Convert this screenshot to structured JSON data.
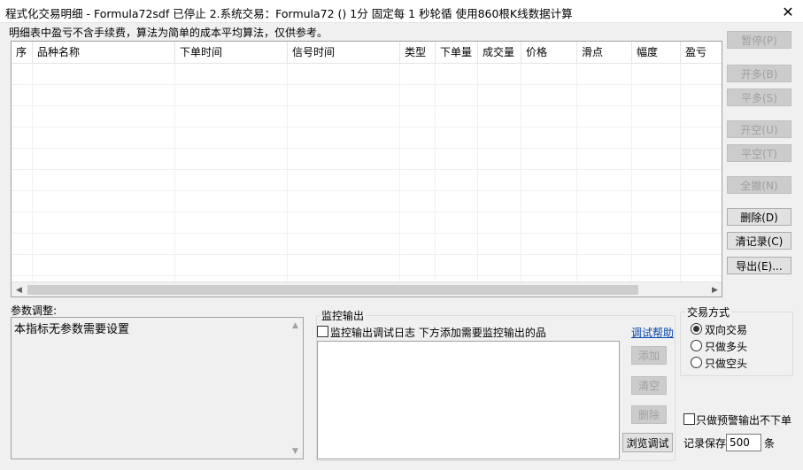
{
  "window": {
    "title": "程式化交易明细 - Formula72sdf 已停止  2.系统交易：Formula72 () 1分 固定每 1 秒轮循 使用860根K线数据计算",
    "close_glyph": "✕"
  },
  "note": "明细表中盈亏不含手续费，算法为简单的成本平均算法，仅供参考。",
  "table": {
    "columns": [
      "序",
      "品种名称",
      "下单时间",
      "信号时间",
      "类型",
      "下单量",
      "成交量",
      "价格",
      "滑点",
      "幅度",
      "盈亏"
    ],
    "rows": []
  },
  "right_buttons": {
    "pause": "暂停(P)",
    "open_long": "开多(B)",
    "close_long": "平多(S)",
    "open_short": "开空(U)",
    "close_short": "平空(T)",
    "cancel_all": "全撤(N)",
    "delete": "删除(D)",
    "clear_records": "清记录(C)",
    "export": "导出(E)..."
  },
  "params": {
    "label": "参数调整:",
    "text": "本指标无参数需要设置"
  },
  "monitor": {
    "legend": "监控输出",
    "checkbox_label": "监控输出调试日志 下方添加需要监控输出的品",
    "help_link": "调试帮助",
    "add": "添加",
    "clear": "清空",
    "remove": "删除",
    "browse": "浏览调试"
  },
  "trade_mode": {
    "legend": "交易方式",
    "options": [
      "双向交易",
      "只做多头",
      "只做空头"
    ],
    "selected": "双向交易"
  },
  "alert_only_label": "只做预警输出不下单",
  "keep_records": {
    "label": "记录保存",
    "value": "500",
    "unit": "条"
  }
}
